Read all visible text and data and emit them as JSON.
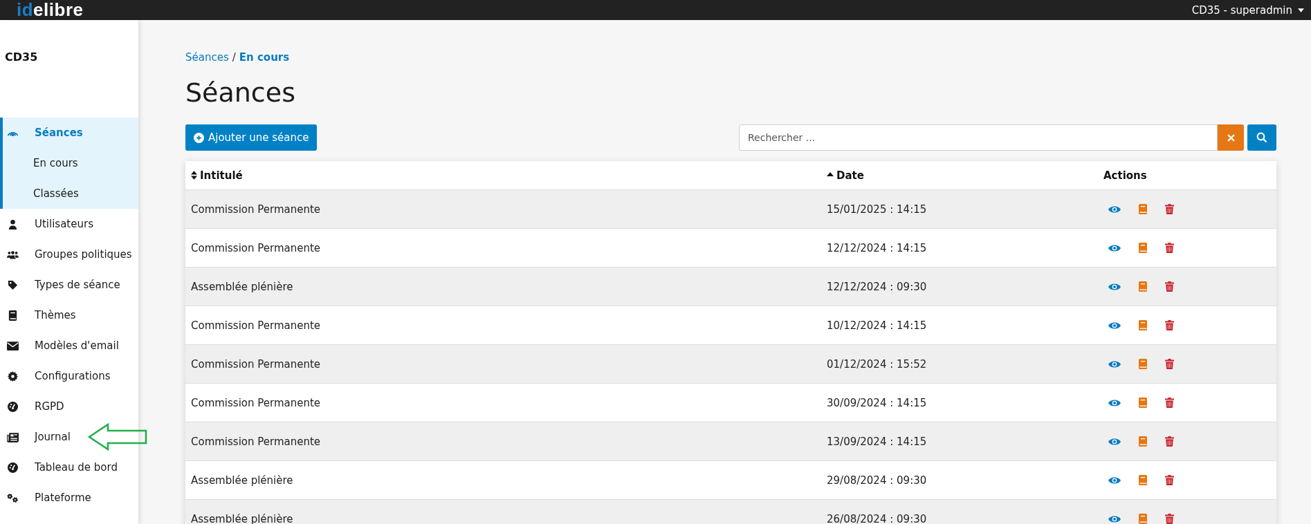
{
  "topbar": {
    "logo_prefix": "id",
    "logo_suffix": "elibre",
    "user_menu": "CD35 - superadmin"
  },
  "sidebar": {
    "title": "CD35",
    "items": [
      {
        "label": "Séances",
        "selected": true,
        "expanded": true,
        "annotated": false,
        "children": [
          {
            "label": "En cours",
            "selected": false
          },
          {
            "label": "Classées",
            "selected": false
          }
        ]
      },
      {
        "label": "Utilisateurs",
        "selected": false,
        "annotated": false
      },
      {
        "label": "Groupes politiques",
        "selected": false,
        "annotated": false
      },
      {
        "label": "Types de séance",
        "selected": false,
        "annotated": false
      },
      {
        "label": "Thèmes",
        "selected": false,
        "annotated": false
      },
      {
        "label": "Modèles d'email",
        "selected": false,
        "annotated": false
      },
      {
        "label": "Configurations",
        "selected": false,
        "annotated": false
      },
      {
        "label": "RGPD",
        "selected": false,
        "annotated": false
      },
      {
        "label": "Journal",
        "selected": false,
        "annotated": true
      },
      {
        "label": "Tableau de bord",
        "selected": false,
        "annotated": false
      },
      {
        "label": "Plateforme",
        "selected": false,
        "annotated": false
      }
    ]
  },
  "breadcrumb": [
    {
      "label": "Séances",
      "current": false
    },
    {
      "label": "En cours",
      "current": true
    }
  ],
  "breadcrumb_separator": "/",
  "page_title": "Séances",
  "add_button": "Ajouter une séance",
  "search": {
    "placeholder": "Rechercher ..."
  },
  "table": {
    "columns": [
      {
        "label": "Intitulé",
        "sorted": false
      },
      {
        "label": "Date",
        "sorted": true
      },
      {
        "label": "Actions"
      }
    ],
    "rows": [
      {
        "title": "Commission Permanente",
        "date": "15/01/2025 : 14:15"
      },
      {
        "title": "Commission Permanente",
        "date": "12/12/2024 : 14:15"
      },
      {
        "title": "Assemblée plénière",
        "date": "12/12/2024 : 09:30"
      },
      {
        "title": "Commission Permanente",
        "date": "10/12/2024 : 14:15"
      },
      {
        "title": "Commission Permanente",
        "date": "01/12/2024 : 15:52"
      },
      {
        "title": "Commission Permanente",
        "date": "30/09/2024 : 14:15"
      },
      {
        "title": "Commission Permanente",
        "date": "13/09/2024 : 14:15"
      },
      {
        "title": "Assemblée plénière",
        "date": "29/08/2024 : 09:30"
      },
      {
        "title": "Assemblée plénière",
        "date": "26/08/2024 : 09:30"
      }
    ]
  }
}
